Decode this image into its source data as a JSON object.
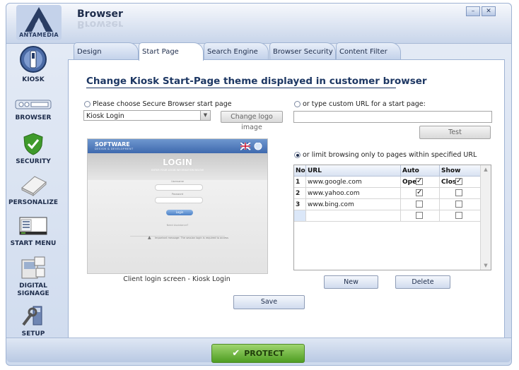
{
  "app": {
    "title": "Browser",
    "logo_text": "ANTAMEDIA",
    "minimize_glyph": "–",
    "close_glyph": "✕"
  },
  "sidebar": {
    "items": [
      {
        "label": "KIOSK",
        "icon": "kiosk-icon"
      },
      {
        "label": "BROWSER",
        "icon": "browser-icon"
      },
      {
        "label": "SECURITY",
        "icon": "security-shield-icon"
      },
      {
        "label": "PERSONALIZE",
        "icon": "personalize-icon"
      },
      {
        "label": "START MENU",
        "icon": "start-menu-icon"
      },
      {
        "label": "DIGITAL",
        "label2": "SIGNAGE",
        "icon": "digital-signage-icon"
      },
      {
        "label": "SETUP",
        "icon": "setup-icon"
      }
    ]
  },
  "tabs": [
    {
      "label": "Design"
    },
    {
      "label": "Start Page",
      "active": true
    },
    {
      "label": "Search Engine"
    },
    {
      "label": "Browser Security"
    },
    {
      "label": "Content Filter"
    }
  ],
  "main": {
    "heading": "Change Kiosk Start-Page theme displayed in customer browser",
    "option_secure": "Please choose Secure Browser start page",
    "option_custom": "or type custom URL for a start page:",
    "option_limit": "or limit browsing only to pages within specified URL",
    "start_page_select": "Kiosk Login",
    "change_logo_button": "Change logo image",
    "test_button": "Test",
    "custom_url_value": "",
    "caption": "Client login screen - Kiosk Login",
    "preview": {
      "brand": "SOFTWARE",
      "brand_sub": "DESIGN & DEVELOPMENT",
      "login": "LOGIN",
      "login_sub": "ENTER YOUR LOGIN INFORMATION BELOW",
      "username": "Username",
      "password": "Password",
      "button": "Login",
      "help": "Need Assistance?",
      "notice": "Important message: The session login is required to access"
    },
    "grid": {
      "headers": [
        "No",
        "URL",
        "Auto Open",
        "Show Close"
      ],
      "rows": [
        {
          "no": "1",
          "url": "www.google.com",
          "auto_open": true,
          "show_close": true
        },
        {
          "no": "2",
          "url": "www.yahoo.com",
          "auto_open": true,
          "show_close": false
        },
        {
          "no": "3",
          "url": "www.bing.com",
          "auto_open": false,
          "show_close": false
        },
        {
          "no": "",
          "url": "",
          "auto_open": false,
          "show_close": false
        }
      ]
    },
    "new_button": "New",
    "delete_button": "Delete",
    "save_button": "Save"
  },
  "footer": {
    "protect_button": "PROTECT"
  },
  "colors": {
    "accent": "#1d3763",
    "protect": "#4e9d22"
  }
}
